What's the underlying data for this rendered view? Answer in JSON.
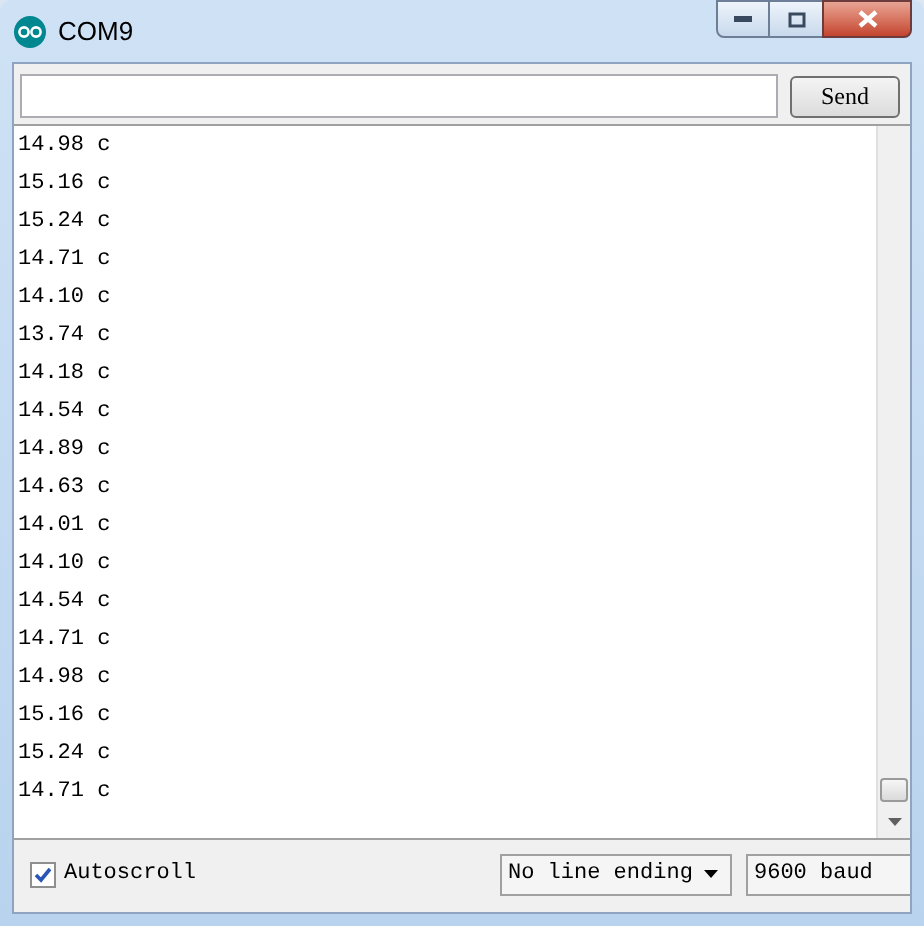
{
  "window": {
    "title": "COM9"
  },
  "send_button": {
    "label": "Send"
  },
  "output_lines": [
    "14.98 c",
    "15.16 c",
    "15.24 c",
    "14.71 c",
    "14.10 c",
    "13.74 c",
    "14.18 c",
    "14.54 c",
    "14.89 c",
    "14.63 c",
    "14.01 c",
    "14.10 c",
    "14.54 c",
    "14.71 c",
    "14.98 c",
    "15.16 c",
    "15.24 c",
    "14.71 c"
  ],
  "autoscroll": {
    "label": "Autoscroll",
    "checked": true
  },
  "line_ending": {
    "value": "No line ending"
  },
  "baud": {
    "value": "9600 baud"
  }
}
